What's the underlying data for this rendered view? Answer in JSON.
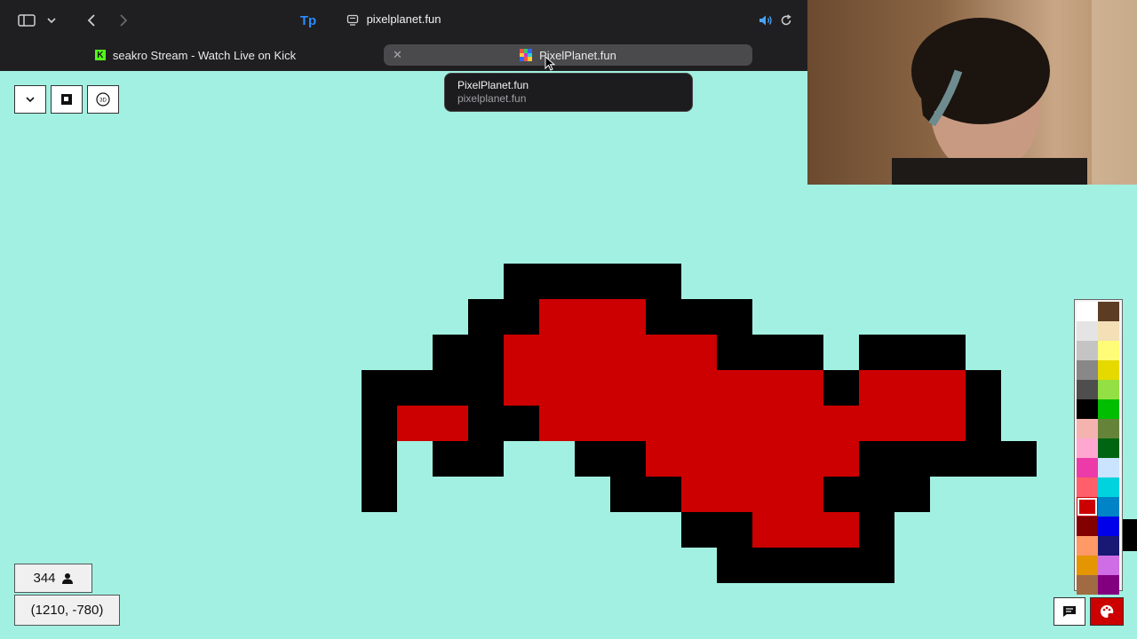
{
  "browser": {
    "address": "pixelplanet.fun",
    "tabs": [
      {
        "label": "seakro Stream - Watch Live on Kick",
        "active": false
      },
      {
        "label": "PixelPlanet.fun",
        "active": true
      }
    ],
    "tooltip": {
      "title": "PixelPlanet.fun",
      "url": "pixelplanet.fun"
    }
  },
  "canvas": {
    "background": "#a2f0e1",
    "colors": {
      "black": "#000000",
      "red": "#cc0000"
    },
    "art_grid": [
      "....#####..........",
      "...##RRR###........",
      "..##RRRRRR###.###..",
      "####RRRRRRRRR#RRR#.",
      "#RR##RRRRRRRRRRRR#.",
      "#.##..##RRRRRR#####",
      "#......##RRRR###...",
      ".........##RRR#....",
      "..........#####...."
    ]
  },
  "controls": {
    "online_count": "344",
    "coordinates": "(1210, -780)",
    "icons": [
      "chevron-down-icon",
      "canvas-select-icon",
      "3d-view-icon",
      "user-icon",
      "chat-icon",
      "palette-icon"
    ]
  },
  "palette": {
    "selected": "#cc0000",
    "colors": [
      "#ffffff",
      "#5c3d24",
      "#e4e4e4",
      "#f3e0b6",
      "#c4c4c4",
      "#fffc77",
      "#888888",
      "#e5d900",
      "#4e4e4e",
      "#94e044",
      "#000000",
      "#02be01",
      "#f4b3ae",
      "#65843a",
      "#ffa7d1",
      "#006513",
      "#ec3ba8",
      "#cae3ff",
      "#fe5f6b",
      "#00d3dd",
      "#cc0000",
      "#0083c7",
      "#820000",
      "#0000ea",
      "#ff9966",
      "#191973",
      "#e59500",
      "#cf6ee4",
      "#a06a42",
      "#820080"
    ]
  }
}
